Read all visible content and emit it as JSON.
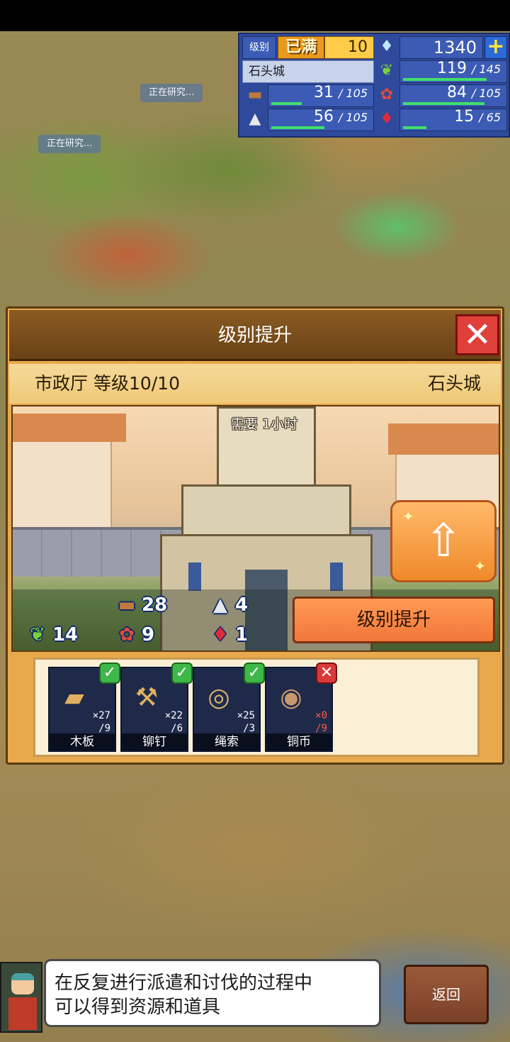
{
  "map": {
    "research_labels": [
      "正在研究...",
      "正在研究..."
    ]
  },
  "hud": {
    "level_label": "级别",
    "level_max": "已满",
    "level_value": "10",
    "gems": "1340",
    "plus": "+",
    "town_name": "石头城",
    "resources": {
      "food": {
        "icon": "grass-icon",
        "current": "119",
        "max": "145",
        "fill": 0.82
      },
      "wood": {
        "icon": "log-icon",
        "current": "31",
        "max": "105",
        "fill": 0.3
      },
      "produce": {
        "icon": "basket-icon",
        "current": "84",
        "max": "105",
        "fill": 0.8
      },
      "stone": {
        "icon": "stone-icon",
        "current": "56",
        "max": "105",
        "fill": 0.53
      },
      "ruby": {
        "icon": "ruby-icon",
        "current": "15",
        "max": "65",
        "fill": 0.23
      }
    }
  },
  "dialog": {
    "title": "级别提升",
    "close_icon": "close-icon",
    "building": "市政厅 等级10/10",
    "town": "石头城",
    "need_time": "需要 1小时",
    "costs": {
      "wood": "28",
      "stone": "4",
      "food": "14",
      "produce": "9",
      "ruby": "1"
    },
    "upgrade_button": "级别提升",
    "items": [
      {
        "name": "木板",
        "have": "×27",
        "need": "/9",
        "ok": true,
        "icon": "plank-icon"
      },
      {
        "name": "铆钉",
        "have": "×22",
        "need": "/6",
        "ok": true,
        "icon": "rivet-icon"
      },
      {
        "name": "绳索",
        "have": "×25",
        "need": "/3",
        "ok": true,
        "icon": "rope-icon"
      },
      {
        "name": "铜币",
        "have": "×0",
        "need": "/9",
        "ok": false,
        "icon": "coin-icon"
      }
    ]
  },
  "tip": {
    "line1": "在反复进行派遣和讨伐的过程中",
    "line2": "可以得到资源和道具"
  },
  "back_button": "返回",
  "colors": {
    "dialog_bg": "#e8a94c",
    "title_bar": "#6b4216",
    "close": "#e0403a",
    "upgrade": "#f2773a",
    "hud": "#2f4a9a",
    "ok_check": "#3fb84a",
    "missing": "#d83a3a"
  }
}
